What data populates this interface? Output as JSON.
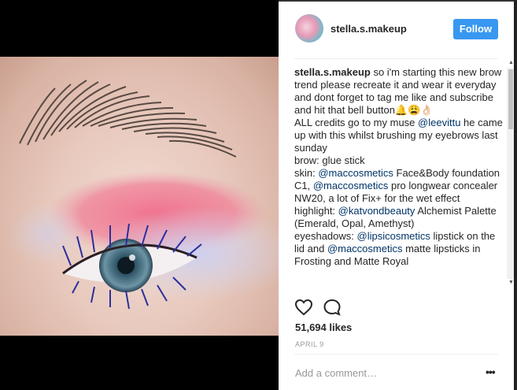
{
  "post": {
    "username": "stella.s.makeup",
    "follow_label": "Follow",
    "caption_parts": [
      {
        "type": "name",
        "text": "stella.s.makeup"
      },
      {
        "type": "text",
        "text": " so i'm starting this new brow trend please recreate it and wear it everyday and dont forget to tag me like and subscribe and hit that bell button🔔😩👌🏻"
      },
      {
        "type": "br"
      },
      {
        "type": "text",
        "text": "ALL credits go to my muse "
      },
      {
        "type": "mention",
        "text": "@leevittu"
      },
      {
        "type": "text",
        "text": " he came up with this whilst brushing my eyebrows last sunday"
      },
      {
        "type": "br"
      },
      {
        "type": "text",
        "text": "brow: glue stick"
      },
      {
        "type": "br"
      },
      {
        "type": "text",
        "text": "skin: "
      },
      {
        "type": "mention",
        "text": "@maccosmetics"
      },
      {
        "type": "text",
        "text": " Face&Body foundation C1, "
      },
      {
        "type": "mention",
        "text": "@maccosmetics"
      },
      {
        "type": "text",
        "text": " pro longwear concealer NW20, a lot of Fix+ for the wet effect"
      },
      {
        "type": "br"
      },
      {
        "type": "text",
        "text": "highlight: "
      },
      {
        "type": "mention",
        "text": "@katvondbeauty"
      },
      {
        "type": "text",
        "text": " Alchemist Palette (Emerald, Opal, Amethyst)"
      },
      {
        "type": "br"
      },
      {
        "type": "text",
        "text": "eyeshadows: "
      },
      {
        "type": "mention",
        "text": "@lipsicosmetics"
      },
      {
        "type": "text",
        "text": " lipstick on the lid and "
      },
      {
        "type": "mention",
        "text": "@maccosmetics"
      },
      {
        "type": "text",
        "text": " matte lipsticks in Frosting and Matte Royal"
      }
    ],
    "likes": "51,694 likes",
    "date": "APRIL 9",
    "add_comment_placeholder": "Add a comment…",
    "more_label": "•••"
  },
  "icons": {
    "like": "heart-icon",
    "comment": "comment-bubble-icon",
    "more": "more-options-icon",
    "scroll_up": "scroll-up-arrow-icon",
    "scroll_down": "scroll-down-arrow-icon"
  },
  "colors": {
    "follow_button": "#3897f0",
    "mention": "#003569",
    "muted_text": "#999999"
  }
}
